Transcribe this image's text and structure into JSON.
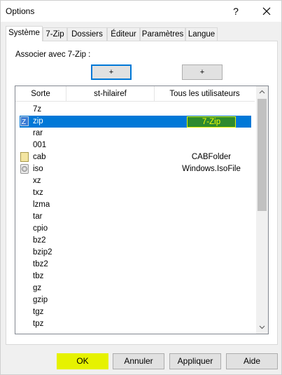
{
  "window": {
    "title": "Options",
    "help_label": "?"
  },
  "tabs": [
    {
      "label": "Système"
    },
    {
      "label": "7-Zip"
    },
    {
      "label": "Dossiers"
    },
    {
      "label": "Éditeur"
    },
    {
      "label": "Paramètres"
    },
    {
      "label": "Langue"
    }
  ],
  "panel": {
    "assoc_label": "Associer avec 7-Zip :",
    "plus_user": "+",
    "plus_all": "+"
  },
  "list": {
    "headers": [
      "Sorte",
      "st-hilairef",
      "Tous les utilisateurs"
    ],
    "rows": [
      {
        "ext": "7z",
        "c3": ""
      },
      {
        "ext": "zip",
        "c3": "7-Zip"
      },
      {
        "ext": "rar",
        "c3": ""
      },
      {
        "ext": "001",
        "c3": ""
      },
      {
        "ext": "cab",
        "c3": "CABFolder"
      },
      {
        "ext": "iso",
        "c3": "Windows.IsoFile"
      },
      {
        "ext": "xz",
        "c3": ""
      },
      {
        "ext": "txz",
        "c3": ""
      },
      {
        "ext": "lzma",
        "c3": ""
      },
      {
        "ext": "tar",
        "c3": ""
      },
      {
        "ext": "cpio",
        "c3": ""
      },
      {
        "ext": "bz2",
        "c3": ""
      },
      {
        "ext": "bzip2",
        "c3": ""
      },
      {
        "ext": "tbz2",
        "c3": ""
      },
      {
        "ext": "tbz",
        "c3": ""
      },
      {
        "ext": "gz",
        "c3": ""
      },
      {
        "ext": "gzip",
        "c3": ""
      },
      {
        "ext": "tgz",
        "c3": ""
      },
      {
        "ext": "tpz",
        "c3": ""
      }
    ]
  },
  "buttons": {
    "ok": "OK",
    "cancel": "Annuler",
    "apply": "Appliquer",
    "help": "Aide"
  },
  "colors": {
    "selection": "#0078d7",
    "highlight": "#e6f200",
    "cell_green": "#2e8b2e"
  },
  "icons": {
    "zip": "7zip-archive-icon",
    "cab": "cabinet-file-icon",
    "iso": "disc-image-icon"
  }
}
